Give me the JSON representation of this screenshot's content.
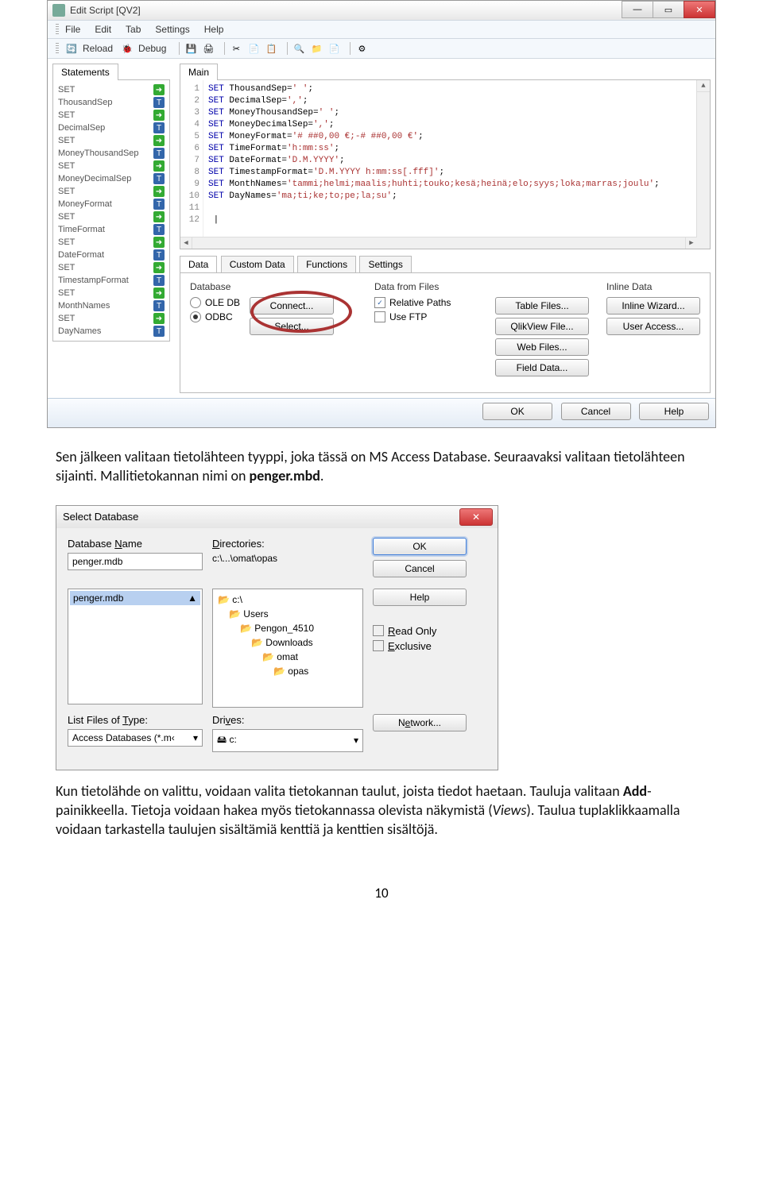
{
  "screenshot1": {
    "title": "Edit Script [QV2]",
    "menus": [
      "File",
      "Edit",
      "Tab",
      "Settings",
      "Help"
    ],
    "toolbar": {
      "reload": "Reload",
      "debug": "Debug"
    },
    "statements_tab": "Statements",
    "statements": [
      "SET",
      "ThousandSep",
      "SET",
      "DecimalSep",
      "SET",
      "MoneyThousandSep",
      "SET",
      "MoneyDecimalSep",
      "SET",
      "MoneyFormat",
      "SET",
      "TimeFormat",
      "SET",
      "DateFormat",
      "SET",
      "TimestampFormat",
      "SET",
      "MonthNames",
      "SET",
      "DayNames"
    ],
    "main_tab": "Main",
    "code_lines": [
      {
        "n": "1",
        "kw": "SET",
        "rest": " ThousandSep=",
        "str": "' '",
        "tail": ";"
      },
      {
        "n": "2",
        "kw": "SET",
        "rest": " DecimalSep=",
        "str": "','",
        "tail": ";"
      },
      {
        "n": "3",
        "kw": "SET",
        "rest": " MoneyThousandSep=",
        "str": "' '",
        "tail": ";"
      },
      {
        "n": "4",
        "kw": "SET",
        "rest": " MoneyDecimalSep=",
        "str": "','",
        "tail": ";"
      },
      {
        "n": "5",
        "kw": "SET",
        "rest": " MoneyFormat=",
        "str": "'# ##0,00 €;-# ##0,00 €'",
        "tail": ";"
      },
      {
        "n": "6",
        "kw": "SET",
        "rest": " TimeFormat=",
        "str": "'h:mm:ss'",
        "tail": ";"
      },
      {
        "n": "7",
        "kw": "SET",
        "rest": " DateFormat=",
        "str": "'D.M.YYYY'",
        "tail": ";"
      },
      {
        "n": "8",
        "kw": "SET",
        "rest": " TimestampFormat=",
        "str": "'D.M.YYYY h:mm:ss[.fff]'",
        "tail": ";"
      },
      {
        "n": "9",
        "kw": "SET",
        "rest": " MonthNames=",
        "str": "'tammi;helmi;maalis;huhti;touko;kesä;heinä;elo;syys;loka;marras;joulu'",
        "tail": ";"
      },
      {
        "n": "10",
        "kw": "SET",
        "rest": " DayNames=",
        "str": "'ma;ti;ke;to;pe;la;su'",
        "tail": ";"
      },
      {
        "n": "11",
        "kw": "",
        "rest": "",
        "str": "",
        "tail": ""
      },
      {
        "n": "12",
        "kw": "",
        "rest": " |",
        "str": "",
        "tail": ""
      }
    ],
    "lower_tabs": [
      "Data",
      "Custom Data",
      "Functions",
      "Settings"
    ],
    "db": {
      "label": "Database",
      "ole": "OLE DB",
      "odbc": "ODBC",
      "connect": "Connect...",
      "select": "Select..."
    },
    "files": {
      "label": "Data from Files",
      "relative": "Relative Paths",
      "ftp": "Use FTP",
      "table": "Table Files...",
      "qlik": "QlikView File...",
      "web": "Web Files...",
      "field": "Field Data..."
    },
    "inline": {
      "label": "Inline Data",
      "wizard": "Inline Wizard...",
      "access": "User Access..."
    },
    "bottom": {
      "ok": "OK",
      "cancel": "Cancel",
      "help": "Help"
    }
  },
  "text1_a": "Sen jälkeen valitaan tietolähteen tyyppi, joka tässä on MS Access Database. Seuraavaksi valitaan tietolähteen sijainti. Mallitietokannan nimi on ",
  "text1_b": "penger.mbd",
  "text1_c": ".",
  "screenshot2": {
    "title": "Select Database",
    "labels": {
      "dbname": "Database Name",
      "dirs": "Directories:",
      "listtype": "List Files of Type:",
      "drives": "Drives:"
    },
    "dbname_value": "penger.mdb",
    "dir_value": "c:\\...\\omat\\opas",
    "list_selected": "penger.mdb",
    "tree": [
      "c:\\",
      "Users",
      "Pengon_4510",
      "Downloads",
      "omat",
      "opas"
    ],
    "listtype_value": "Access Databases (*.m‹",
    "drive_value": "c:",
    "buttons": {
      "ok": "OK",
      "cancel": "Cancel",
      "help": "Help",
      "network": "Network..."
    },
    "checks": {
      "readonly": "Read Only",
      "exclusive": "Exclusive"
    }
  },
  "text2_a": "Kun tietolähde on valittu, voidaan valita tietokannan taulut, joista tiedot haetaan. Tauluja valitaan ",
  "text2_b": "Add",
  "text2_c": "-painikkeella. Tietoja voidaan hakea myös tietokannassa olevista näkymistä (",
  "text2_d": "Views",
  "text2_e": "). Taulua tuplaklikkaamalla voidaan tarkastella taulujen sisältämiä kenttiä ja kenttien sisältöjä.",
  "pagenum": "10"
}
